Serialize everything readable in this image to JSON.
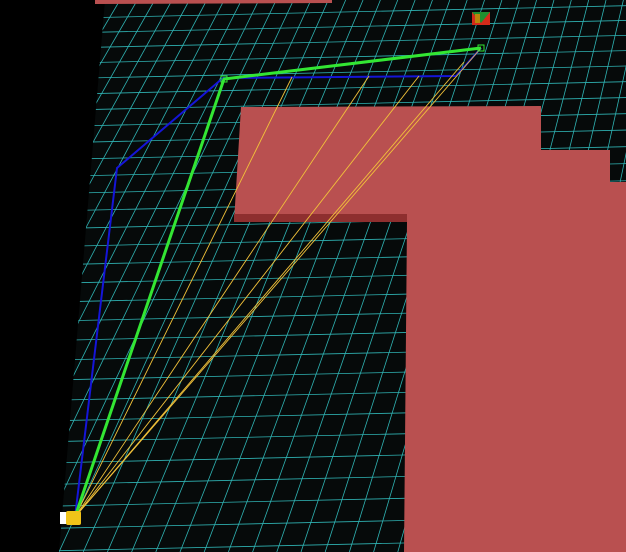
{
  "scene": {
    "background_color": "#000000",
    "floor_color": "#060a0a",
    "grid_color": "#2fb3b3",
    "obstacle_color": "#b95050",
    "obstacle_edge_color": "#8e2f2f",
    "path_blue_color": "#1515d8",
    "path_green_color": "#33e633",
    "ray_color": "#f2c23a",
    "goal_marker_colors": [
      "#d42a1a",
      "#1f8f2f",
      "#b8860b"
    ],
    "start_marker_colors": [
      "#f0c419",
      "#ffffff"
    ]
  },
  "icons": {
    "goal": "goal-flag-icon",
    "start": "start-robot-icon"
  }
}
